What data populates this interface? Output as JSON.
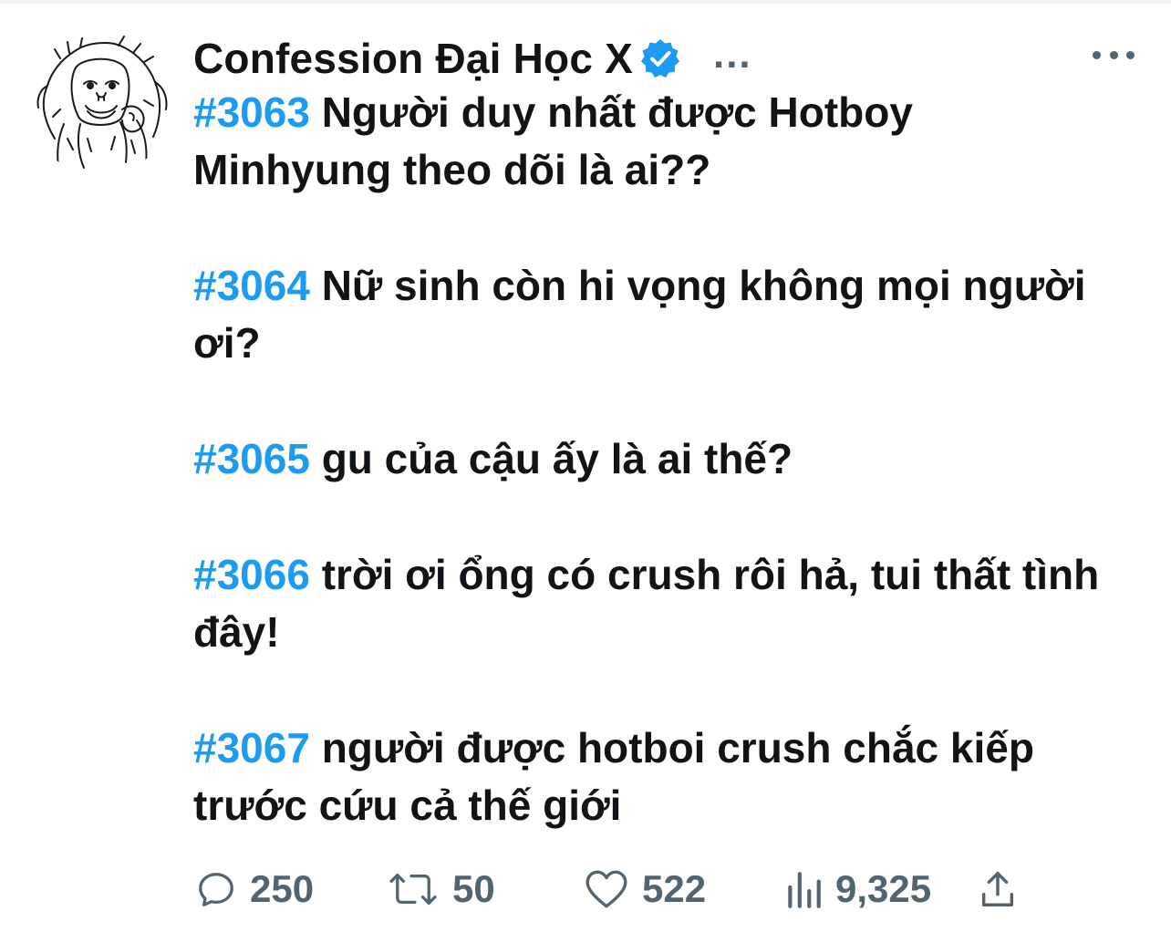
{
  "tweet": {
    "display_name": "Confession Đại Học X",
    "verified_icon": "verified-badge-icon",
    "header_more": "...",
    "posts": [
      {
        "tag": "#3063",
        "text": "Người duy nhất được Hotboy Minhyung theo dõi là ai??"
      },
      {
        "tag": "#3064",
        "text": "Nữ sinh còn hi vọng không mọi người ơi?"
      },
      {
        "tag": "#3065",
        "text": "gu của cậu ấy là ai thế?"
      },
      {
        "tag": "#3066",
        "text": "trời ơi ổng có crush rôi hả, tui thất tình đây!"
      },
      {
        "tag": "#3067",
        "text": "người được hotboi crush chắc kiếp trước cứu cả thế giới"
      }
    ]
  },
  "actions": {
    "replies": "250",
    "retweets": "50",
    "likes": "522",
    "views": "9,325"
  },
  "colors": {
    "hashtag": "#1d9bf0",
    "verified": "#1d9bf0",
    "text": "#0f1419",
    "muted": "#536471"
  }
}
